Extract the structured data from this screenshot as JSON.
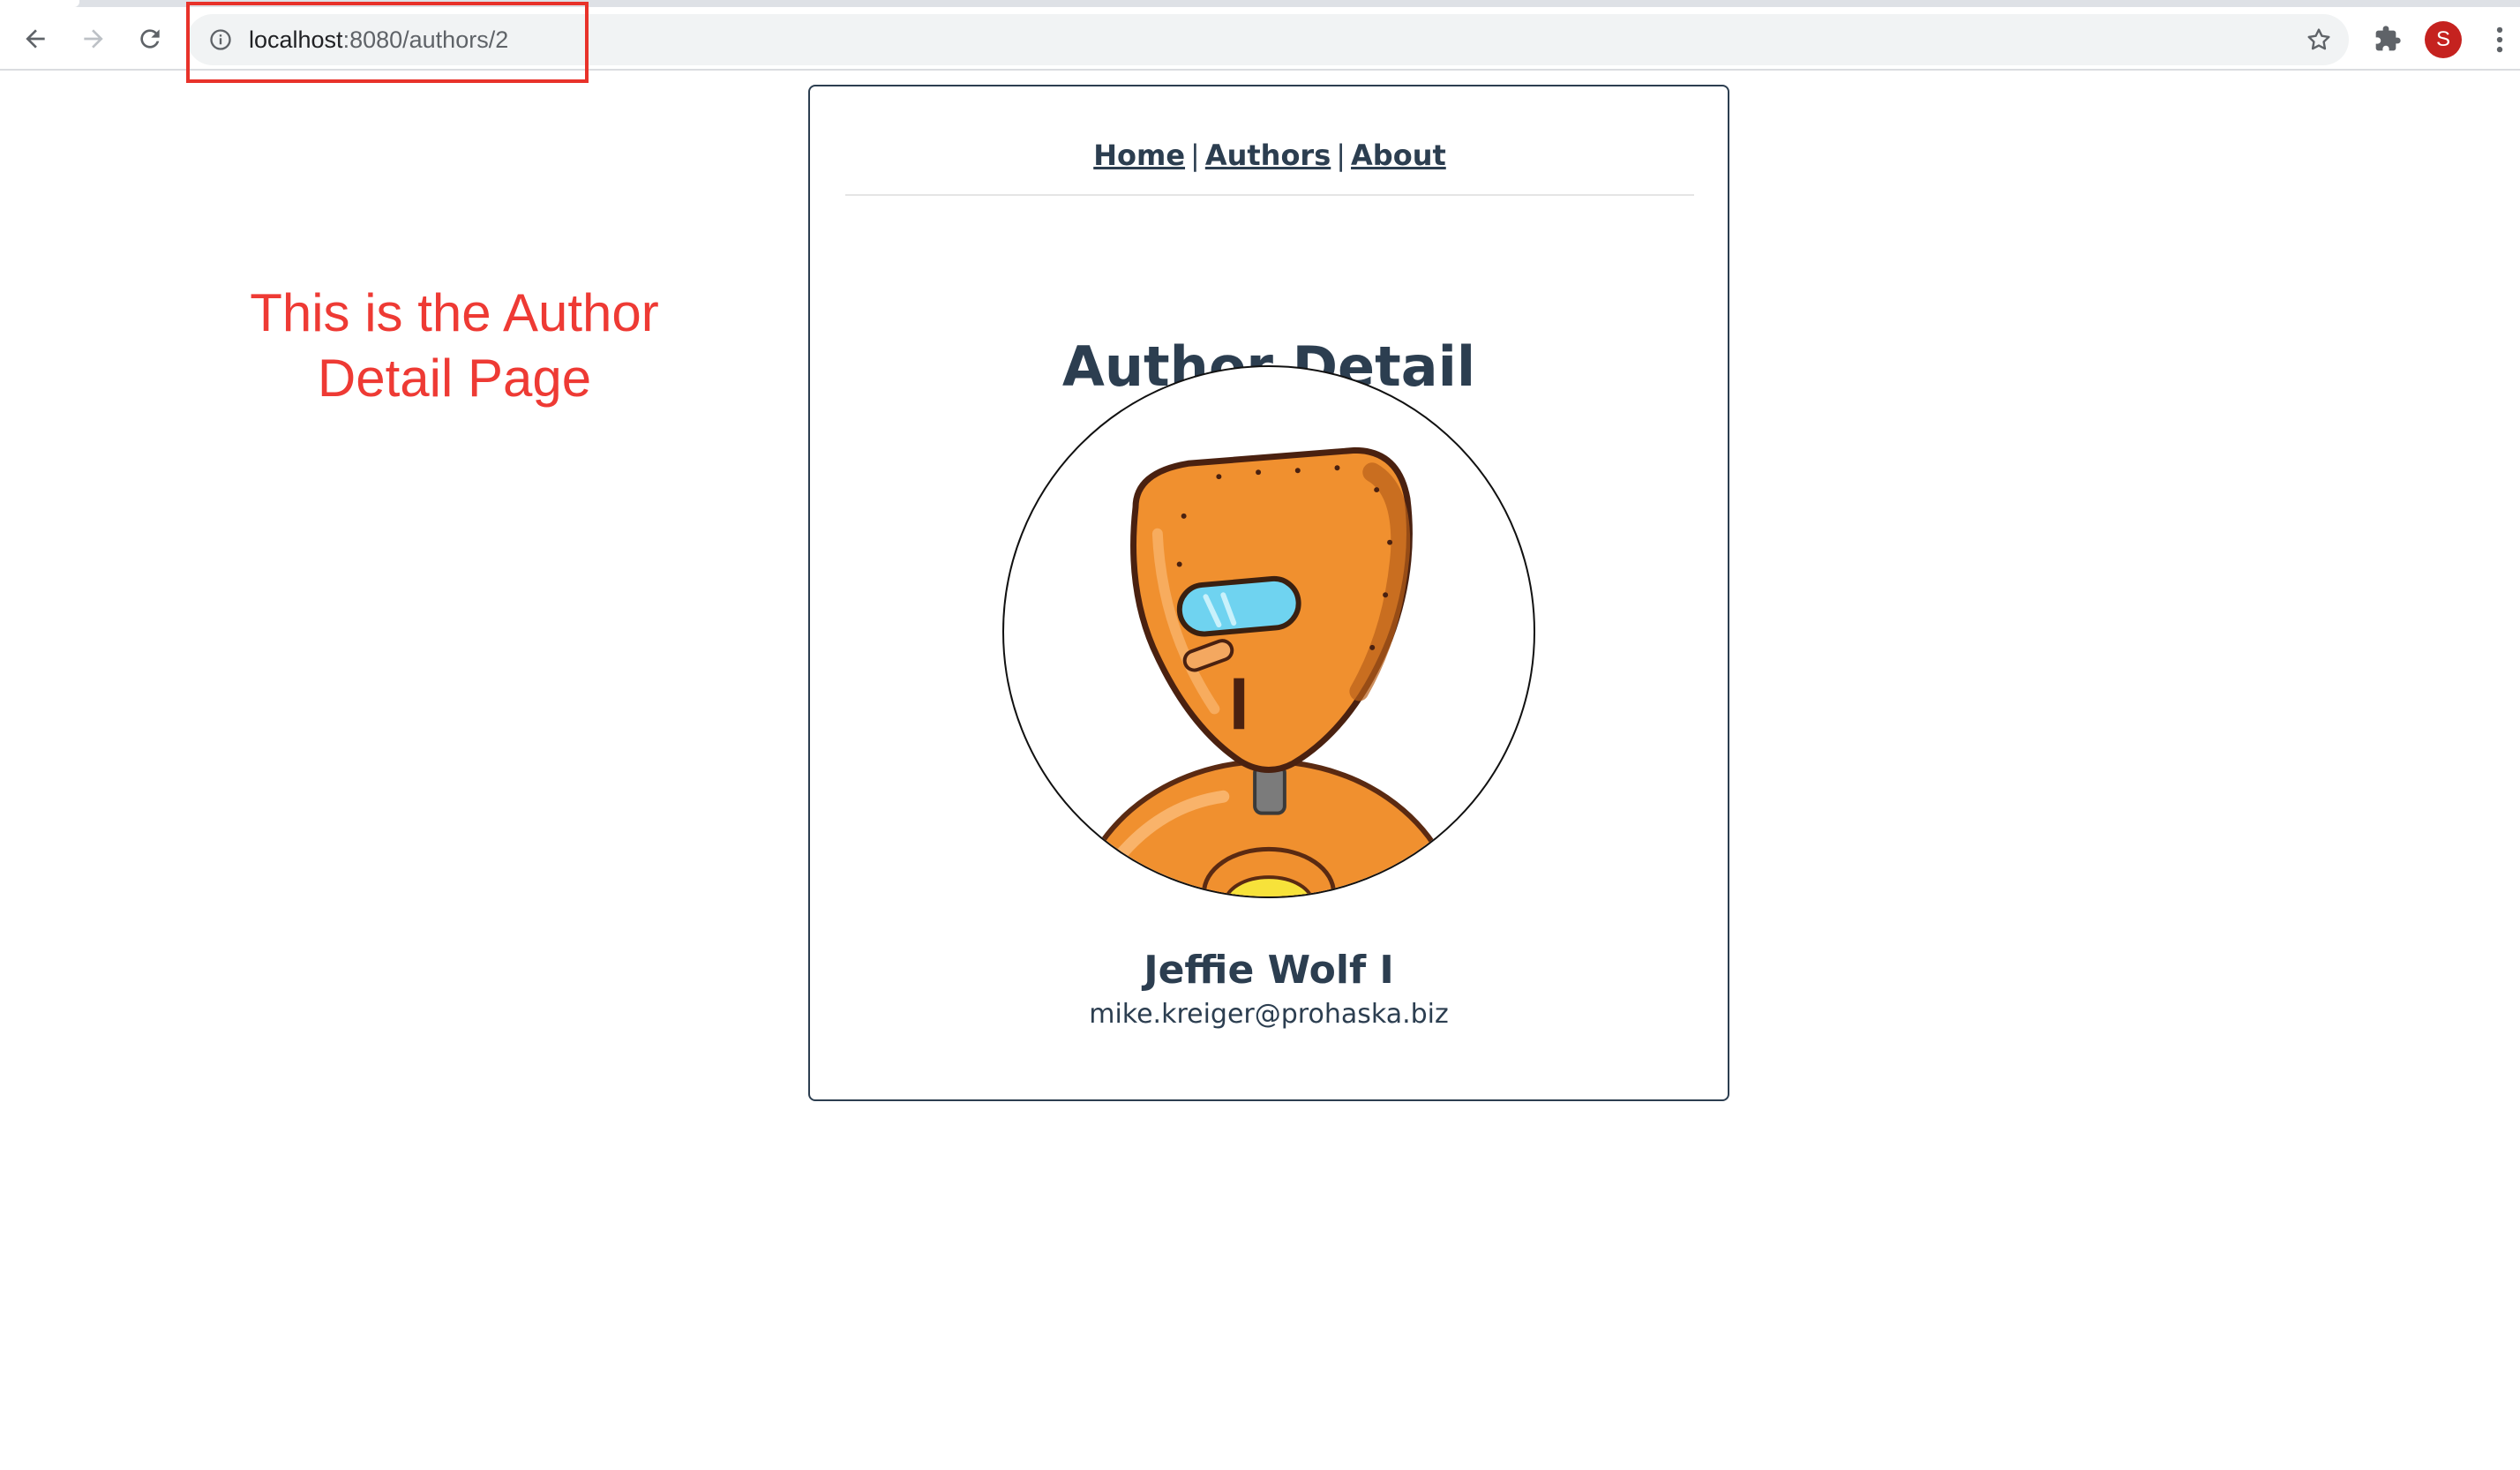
{
  "browser": {
    "url_host": "localhost",
    "url_rest": ":8080/authors/2",
    "profile_initial": "S",
    "icons": {
      "back": "back-arrow-icon",
      "forward": "forward-arrow-icon",
      "reload": "reload-icon",
      "site_info": "info-icon",
      "bookmark": "star-icon",
      "extensions": "puzzle-icon",
      "menu": "kebab-menu-icon"
    }
  },
  "annotation": {
    "line1": "This is the Author",
    "line2": "Detail Page",
    "color": "#ee3a34"
  },
  "app": {
    "nav": {
      "home": "Home",
      "authors": "Authors",
      "about": "About",
      "separator": "|"
    },
    "title": "Author Detail",
    "author": {
      "name": "Jeffie Wolf I",
      "email": "mike.kreiger@prohaska.biz",
      "avatar_icon": "robot-avatar"
    },
    "accent_color": "#2c3e50"
  }
}
